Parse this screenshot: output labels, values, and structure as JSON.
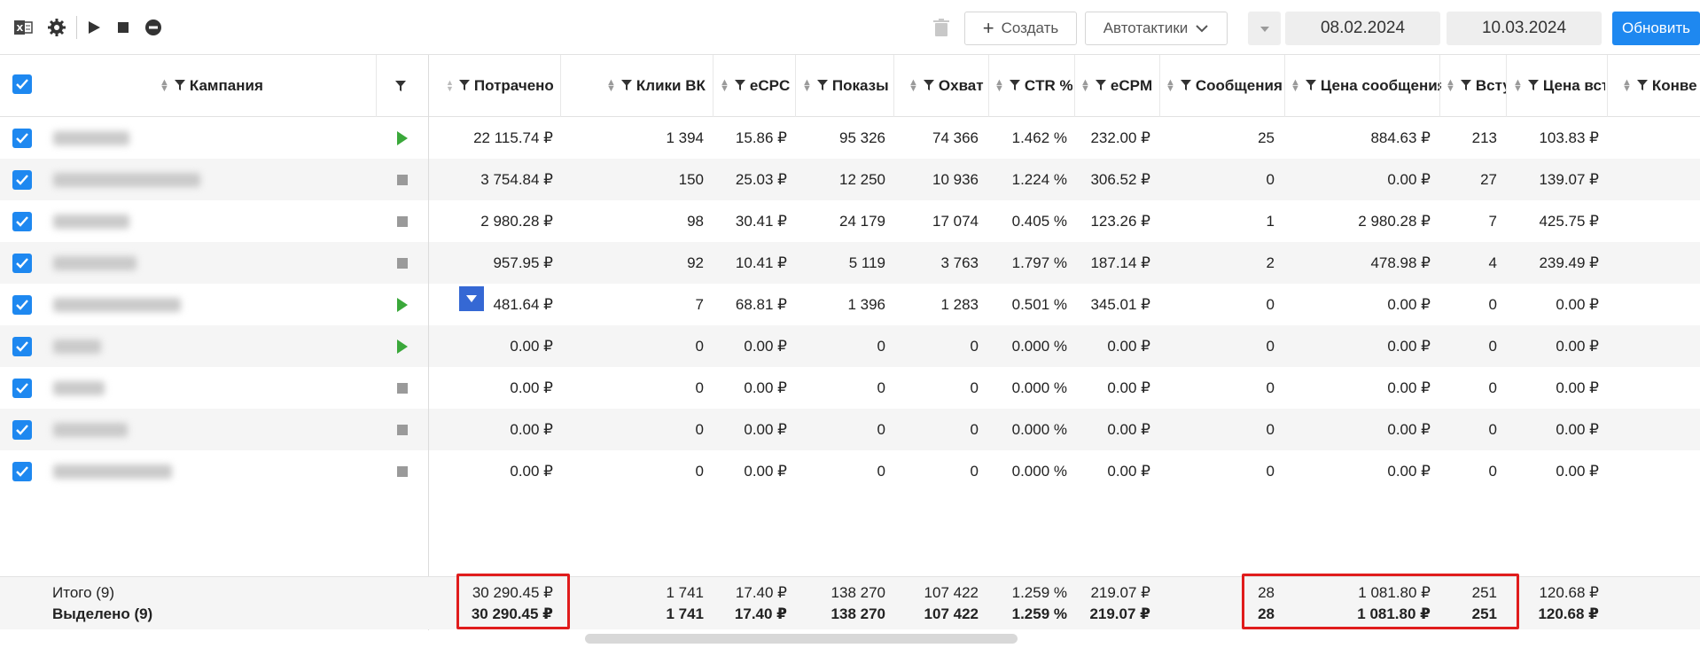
{
  "toolbar": {
    "create_label": "Создать",
    "autotactics_label": "Автотактики",
    "date_from": "08.02.2024",
    "date_to": "10.03.2024",
    "refresh_label": "Обновить",
    "accent": "#1e88f0"
  },
  "columns": [
    {
      "key": "campaign",
      "label": "Кампания"
    },
    {
      "key": "spent",
      "label": "Потрачено"
    },
    {
      "key": "clicks",
      "label": "Клики ВК"
    },
    {
      "key": "ecpc",
      "label": "eCPC"
    },
    {
      "key": "shows",
      "label": "Показы"
    },
    {
      "key": "reach",
      "label": "Охват"
    },
    {
      "key": "ctr",
      "label": "CTR %"
    },
    {
      "key": "ecpm",
      "label": "eCPM"
    },
    {
      "key": "messages",
      "label": "Сообщения"
    },
    {
      "key": "msg_price",
      "label": "Цена сообщения"
    },
    {
      "key": "joins",
      "label": "Всту"
    },
    {
      "key": "join_price",
      "label": "Цена вст"
    },
    {
      "key": "conv",
      "label": "Конве"
    }
  ],
  "rows": [
    {
      "status": "playing",
      "spent": "22 115.74 ₽",
      "clicks": "1 394",
      "ecpc": "15.86 ₽",
      "shows": "95 326",
      "reach": "74 366",
      "ctr": "1.462 %",
      "ecpm": "232.00 ₽",
      "messages": "25",
      "msg_price": "884.63 ₽",
      "joins": "213",
      "join_price": "103.83 ₽"
    },
    {
      "status": "stopped",
      "spent": "3 754.84 ₽",
      "clicks": "150",
      "ecpc": "25.03 ₽",
      "shows": "12 250",
      "reach": "10 936",
      "ctr": "1.224 %",
      "ecpm": "306.52 ₽",
      "messages": "0",
      "msg_price": "0.00 ₽",
      "joins": "27",
      "join_price": "139.07 ₽"
    },
    {
      "status": "stopped",
      "spent": "2 980.28 ₽",
      "clicks": "98",
      "ecpc": "30.41 ₽",
      "shows": "24 179",
      "reach": "17 074",
      "ctr": "0.405 %",
      "ecpm": "123.26 ₽",
      "messages": "1",
      "msg_price": "2 980.28 ₽",
      "joins": "7",
      "join_price": "425.75 ₽"
    },
    {
      "status": "stopped",
      "spent": "957.95 ₽",
      "clicks": "92",
      "ecpc": "10.41 ₽",
      "shows": "5 119",
      "reach": "3 763",
      "ctr": "1.797 %",
      "ecpm": "187.14 ₽",
      "messages": "2",
      "msg_price": "478.98 ₽",
      "joins": "4",
      "join_price": "239.49 ₽"
    },
    {
      "status": "playing",
      "spent": "481.64 ₽",
      "clicks": "7",
      "ecpc": "68.81 ₽",
      "shows": "1 396",
      "reach": "1 283",
      "ctr": "0.501 %",
      "ecpm": "345.01 ₽",
      "messages": "0",
      "msg_price": "0.00 ₽",
      "joins": "0",
      "join_price": "0.00 ₽"
    },
    {
      "status": "playing",
      "spent": "0.00 ₽",
      "clicks": "0",
      "ecpc": "0.00 ₽",
      "shows": "0",
      "reach": "0",
      "ctr": "0.000 %",
      "ecpm": "0.00 ₽",
      "messages": "0",
      "msg_price": "0.00 ₽",
      "joins": "0",
      "join_price": "0.00 ₽"
    },
    {
      "status": "stopped",
      "spent": "0.00 ₽",
      "clicks": "0",
      "ecpc": "0.00 ₽",
      "shows": "0",
      "reach": "0",
      "ctr": "0.000 %",
      "ecpm": "0.00 ₽",
      "messages": "0",
      "msg_price": "0.00 ₽",
      "joins": "0",
      "join_price": "0.00 ₽"
    },
    {
      "status": "stopped",
      "spent": "0.00 ₽",
      "clicks": "0",
      "ecpc": "0.00 ₽",
      "shows": "0",
      "reach": "0",
      "ctr": "0.000 %",
      "ecpm": "0.00 ₽",
      "messages": "0",
      "msg_price": "0.00 ₽",
      "joins": "0",
      "join_price": "0.00 ₽"
    },
    {
      "status": "stopped",
      "spent": "0.00 ₽",
      "clicks": "0",
      "ecpc": "0.00 ₽",
      "shows": "0",
      "reach": "0",
      "ctr": "0.000 %",
      "ecpm": "0.00 ₽",
      "messages": "0",
      "msg_price": "0.00 ₽",
      "joins": "0",
      "join_price": "0.00 ₽"
    }
  ],
  "totals": {
    "label": "Итого (9)",
    "spent": "30 290.45 ₽",
    "clicks": "1 741",
    "ecpc": "17.40 ₽",
    "shows": "138 270",
    "reach": "107 422",
    "ctr": "1.259 %",
    "ecpm": "219.07 ₽",
    "messages": "28",
    "msg_price": "1 081.80 ₽",
    "joins": "251",
    "join_price": "120.68 ₽"
  },
  "selected": {
    "label": "Выделено (9)",
    "spent": "30 290.45 ₽",
    "clicks": "1 741",
    "ecpc": "17.40 ₽",
    "shows": "138 270",
    "reach": "107 422",
    "ctr": "1.259 %",
    "ecpm": "219.07 ₽",
    "messages": "28",
    "msg_price": "1 081.80 ₽",
    "joins": "251",
    "join_price": "120.68 ₽"
  },
  "colors": {
    "highlight": "#e01c1c",
    "play": "#3aa83a",
    "checkbox": "#1e88f0"
  }
}
